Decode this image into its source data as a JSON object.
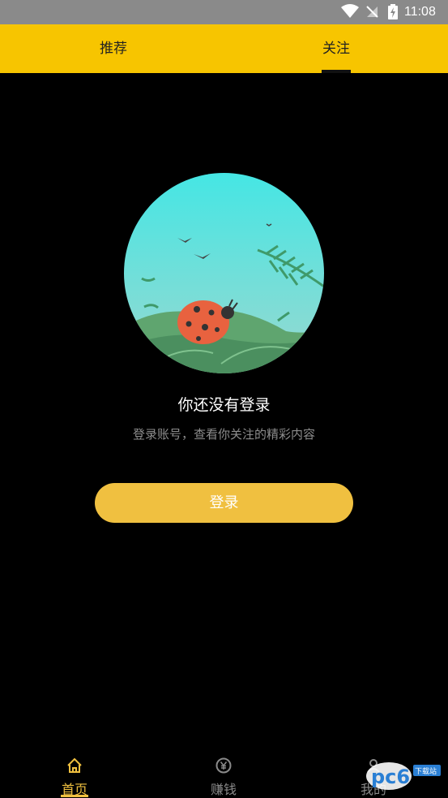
{
  "status_bar": {
    "time": "11:08",
    "icons": [
      "wifi-icon",
      "no-sim-icon",
      "battery-charging-icon"
    ]
  },
  "top_tabs": [
    {
      "label": "推荐",
      "active": false
    },
    {
      "label": "关注",
      "active": true
    }
  ],
  "empty_state": {
    "title": "你还没有登录",
    "subtitle": "登录账号，查看你关注的精彩内容",
    "illustration": "ladybug-illustration"
  },
  "login_button": {
    "label": "登录"
  },
  "bottom_nav": [
    {
      "label": "首页",
      "icon": "home-icon",
      "active": true
    },
    {
      "label": "赚钱",
      "icon": "yen-coin-icon",
      "active": false
    },
    {
      "label": "我的",
      "icon": "profile-icon",
      "active": false
    }
  ],
  "watermark": {
    "text": "pc6",
    "small_text": "下载站"
  },
  "colors": {
    "accent": "#f7c500",
    "button": "#f0c040",
    "background": "#000000",
    "subtitle": "#8d8d8d"
  }
}
